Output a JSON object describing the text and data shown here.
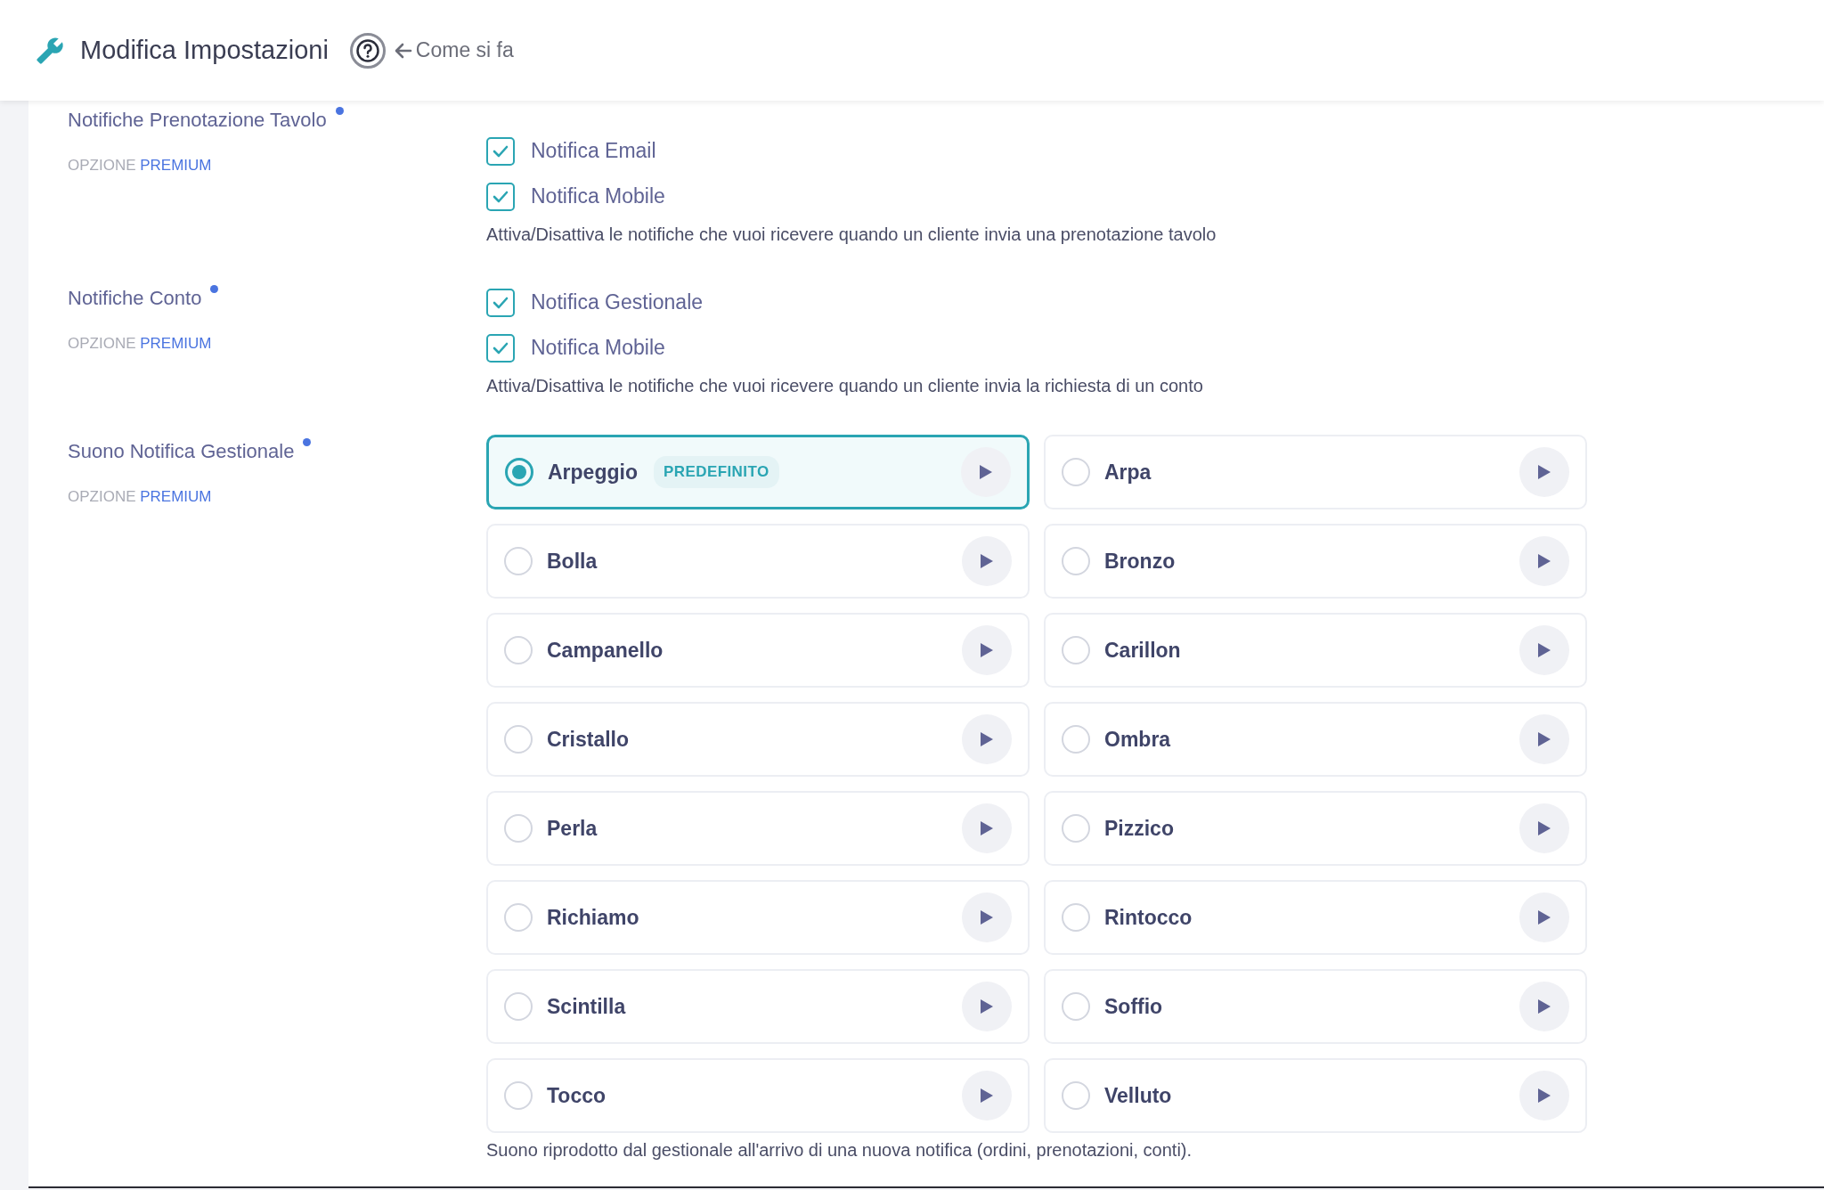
{
  "header": {
    "title": "Modifica Impostazioni",
    "help_link": "Come si fa"
  },
  "sections": [
    {
      "kind": "checks",
      "label": "Notifiche Prenotazione Tavolo",
      "option_prefix": "OPZIONE",
      "option_tier": "PREMIUM",
      "checks": [
        {
          "label": "Notifica Email",
          "checked": true
        },
        {
          "label": "Notifica Mobile",
          "checked": true
        }
      ],
      "description": "Attiva/Disattiva le notifiche che vuoi ricevere quando un cliente invia una prenotazione tavolo"
    },
    {
      "kind": "checks",
      "label": "Notifiche Conto",
      "option_prefix": "OPZIONE",
      "option_tier": "PREMIUM",
      "checks": [
        {
          "label": "Notifica Gestionale",
          "checked": true
        },
        {
          "label": "Notifica Mobile",
          "checked": true
        }
      ],
      "description": "Attiva/Disattiva le notifiche che vuoi ricevere quando un cliente invia la richiesta di un conto"
    },
    {
      "kind": "sounds",
      "label": "Suono Notifica Gestionale",
      "option_prefix": "OPZIONE",
      "option_tier": "PREMIUM",
      "sounds": [
        {
          "name": "Arpeggio",
          "selected": true,
          "badge": "PREDEFINITO"
        },
        {
          "name": "Arpa",
          "selected": false
        },
        {
          "name": "Bolla",
          "selected": false
        },
        {
          "name": "Bronzo",
          "selected": false
        },
        {
          "name": "Campanello",
          "selected": false
        },
        {
          "name": "Carillon",
          "selected": false
        },
        {
          "name": "Cristallo",
          "selected": false
        },
        {
          "name": "Ombra",
          "selected": false
        },
        {
          "name": "Perla",
          "selected": false
        },
        {
          "name": "Pizzico",
          "selected": false
        },
        {
          "name": "Richiamo",
          "selected": false
        },
        {
          "name": "Rintocco",
          "selected": false
        },
        {
          "name": "Scintilla",
          "selected": false
        },
        {
          "name": "Soffio",
          "selected": false
        },
        {
          "name": "Tocco",
          "selected": false
        },
        {
          "name": "Velluto",
          "selected": false
        }
      ],
      "description": "Suono riprodotto dal gestionale all'arrivo di una nuova notifica (ordini, prenotazioni, conti)."
    }
  ]
}
